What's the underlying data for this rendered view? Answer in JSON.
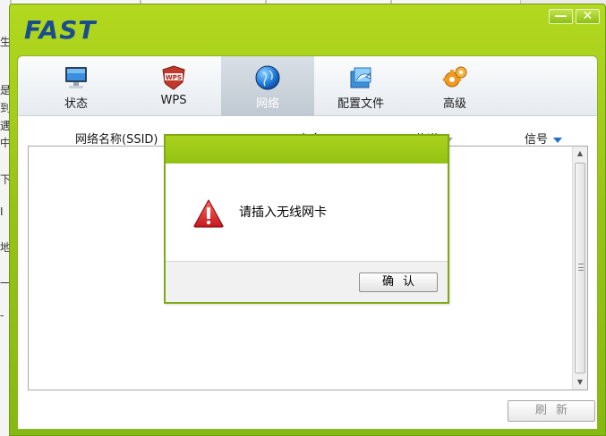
{
  "background_window": {
    "fragments": [
      "生",
      "是",
      "到",
      "遇",
      "中",
      "下",
      "I",
      "地",
      "一",
      "-"
    ]
  },
  "app": {
    "logo": "FAST",
    "minimize_glyph": "—",
    "close_glyph": "✕",
    "tabs": [
      {
        "label": "状态",
        "icon": "monitor-icon",
        "active": false
      },
      {
        "label": "WPS",
        "icon": "wps-shield-icon",
        "active": false
      },
      {
        "label": "网络",
        "icon": "network-globe-icon",
        "active": true
      },
      {
        "label": "配置文件",
        "icon": "profile-config-icon",
        "active": false
      },
      {
        "label": "高级",
        "icon": "gears-icon",
        "active": false
      }
    ],
    "columns": {
      "ssid": "网络名称(SSID)",
      "security": "安全",
      "channel": "信道",
      "signal": "信号"
    },
    "refresh_label": "刷新"
  },
  "dialog": {
    "message": "请插入无线网卡",
    "ok_label": "确认",
    "icon": "warning-icon"
  },
  "colors": {
    "frame_green": "#97c516",
    "logo_blue": "#1a4d8f",
    "warning_red": "#d92b2b"
  }
}
